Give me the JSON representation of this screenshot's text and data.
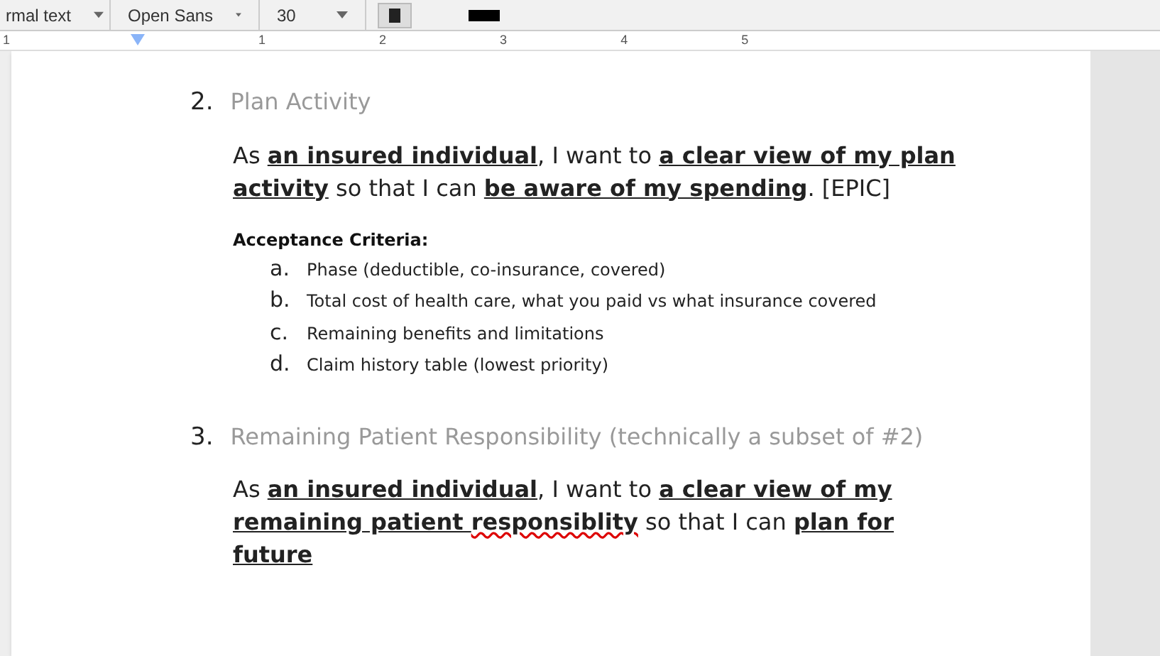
{
  "toolbar": {
    "style_dropdown": "rmal text",
    "font_dropdown": "Open Sans",
    "size_dropdown": "30",
    "bold_selected": true
  },
  "ruler": {
    "labels": [
      "1",
      "1",
      "2",
      "3",
      "4",
      "5"
    ]
  },
  "sections": [
    {
      "number": "2.",
      "title": "Plan Activity",
      "story": [
        {
          "text": "As ",
          "key": false,
          "misspelled": false
        },
        {
          "text": "an insured individual",
          "key": true,
          "misspelled": false
        },
        {
          "text": ", I want to ",
          "key": false,
          "misspelled": false
        },
        {
          "text": "a clear view of my plan activity",
          "key": true,
          "misspelled": false
        },
        {
          "text": " so that I can ",
          "key": false,
          "misspelled": false
        },
        {
          "text": "be aware of my spending",
          "key": true,
          "misspelled": false
        },
        {
          "text": ".  [EPIC]",
          "key": false,
          "misspelled": false
        }
      ],
      "criteria_heading": "Acceptance Criteria:",
      "criteria": [
        {
          "marker": "a.",
          "text": "Phase (deductible, co-insurance, covered)"
        },
        {
          "marker": "b.",
          "text": "Total cost of health care, what you paid vs what insurance covered"
        },
        {
          "marker": "c.",
          "text": "Remaining benefits and limitations"
        },
        {
          "marker": "d.",
          "text": "Claim history table (lowest priority)"
        }
      ]
    },
    {
      "number": "3.",
      "title": "Remaining Patient Responsibility (technically a subset of #2)",
      "story": [
        {
          "text": "As ",
          "key": false,
          "misspelled": false
        },
        {
          "text": "an insured individual",
          "key": true,
          "misspelled": false
        },
        {
          "text": ", I want to ",
          "key": false,
          "misspelled": false
        },
        {
          "text": "a clear view of my remaining patient ",
          "key": true,
          "misspelled": false
        },
        {
          "text": "responsiblity",
          "key": true,
          "misspelled": true
        },
        {
          "text": " so that I can ",
          "key": false,
          "misspelled": false
        },
        {
          "text": "plan for future",
          "key": true,
          "misspelled": false
        }
      ]
    }
  ]
}
